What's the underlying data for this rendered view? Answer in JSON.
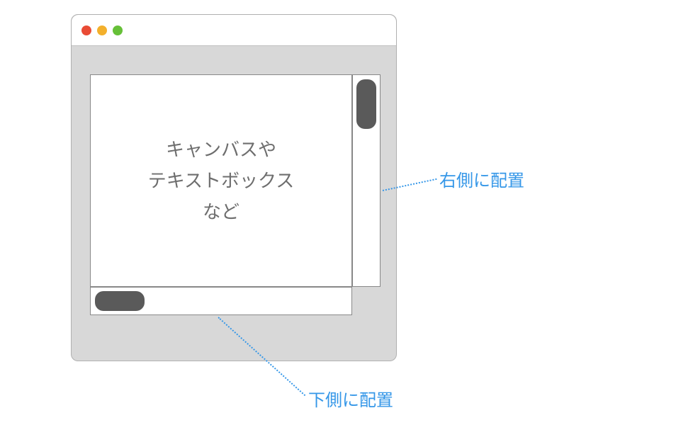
{
  "canvas": {
    "text": "キャンバスや\nテキストボックス\nなど"
  },
  "annotations": {
    "right": "右側に配置",
    "bottom": "下側に配置"
  }
}
